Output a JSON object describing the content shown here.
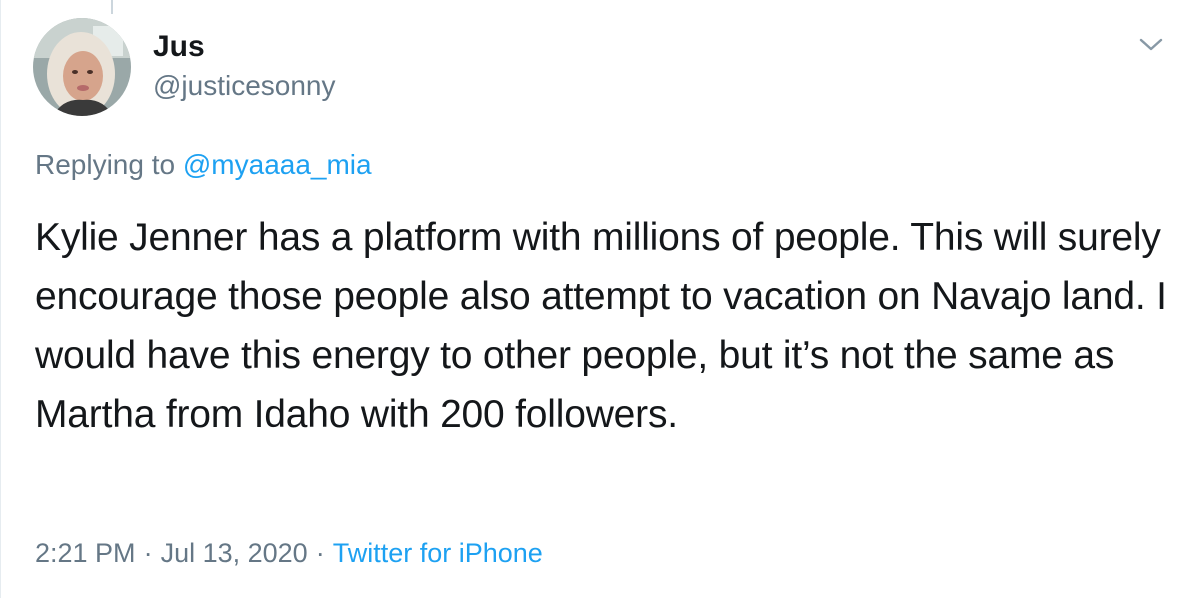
{
  "author": {
    "display_name": "Jus",
    "handle": "@justicesonny"
  },
  "reply": {
    "prefix": "Replying to",
    "mention": "@myaaaa_mia"
  },
  "tweet": {
    "text": "Kylie Jenner has a platform with millions of people. This will surely encourage those people also attempt to vacation on Navajo land. I would have this energy to other people, but it’s not the same as Martha from Idaho with 200 followers."
  },
  "meta": {
    "time": "2:21 PM",
    "separator": "·",
    "date": "Jul 13, 2020",
    "source": "Twitter for iPhone"
  },
  "icons": {
    "menu": "chevron-down-icon"
  },
  "colors": {
    "link": "#1da1f2",
    "secondary_text": "#657786",
    "primary_text": "#14171a"
  }
}
